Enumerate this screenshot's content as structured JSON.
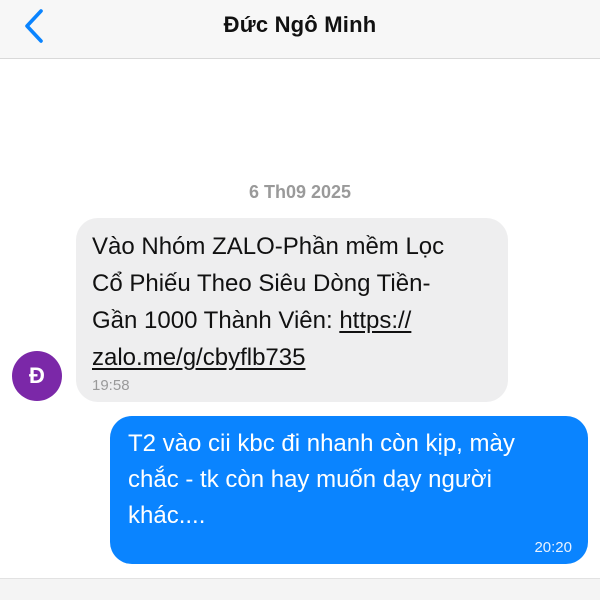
{
  "header": {
    "title": "Đức Ngô Minh",
    "back_icon": "chevron-left-icon",
    "accent_color": "#0a84ff"
  },
  "conversation": {
    "date_separator": "6 Th09 2025",
    "incoming": {
      "avatar_initial": "Đ",
      "avatar_color": "#7b28a8",
      "text_lines": [
        "Vào Nhóm ZALO-Phần mềm Lọc",
        "Cổ Phiếu Theo Siêu Dòng Tiền-",
        "Gần 1000 Thành Viên: "
      ],
      "link_part1": "https://",
      "link_part2": "zalo.me/g/cbyflb735",
      "time": "19:58"
    },
    "outgoing": {
      "text_lines": [
        "T2 vào cii kbc đi nhanh còn kịp, mày",
        "chắc - tk còn hay muốn dạy người",
        "khác...."
      ],
      "time": "20:20",
      "bubble_color": "#0a84ff"
    }
  }
}
